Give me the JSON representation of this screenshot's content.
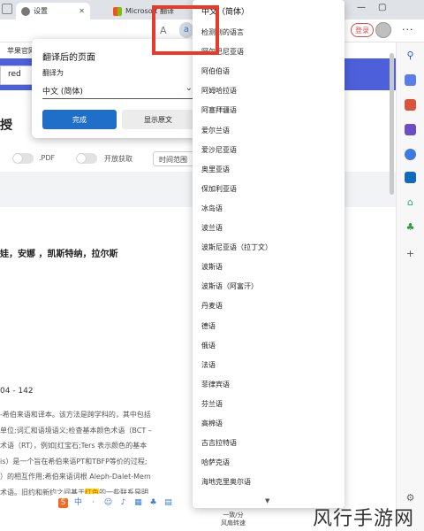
{
  "tabs": [
    {
      "title": "设置",
      "close": "✕"
    },
    {
      "title": "Microsoft 翻译",
      "close": "✕"
    }
  ],
  "window_controls": [
    "—",
    "▢"
  ],
  "toolbar": {
    "login_label": "登录",
    "more": "···",
    "read_aloud": "A",
    "translate_icon_text": "a"
  },
  "page": {
    "bookmark": "苹果官网",
    "search_value": "red",
    "big_char": "授",
    "filters": {
      "pdf": ".PDF",
      "open_access": "开放获取",
      "time_range": "时间范围"
    },
    "authors": "娃，安娜 ，凯斯特纳，拉尔斯",
    "pages": "04 - 142",
    "abstract_lines": [
      "-希伯来语和译本。该方法是跨学科的，其中包括",
      "单位;词汇和语境语义;检查基本颜色术语（BCT –",
      "术语（RT），例如[红宝石;Ters 表示颜色的基本",
      "is）是一个旨在希伯来语PT和TBFP等价的过程;",
      "）的相互作用;希伯来语词根 Aleph-Dalet-Mem",
      "术语。旧约和新约之间基于"
    ],
    "abstract_highlight": "红色",
    "abstract_tail": "的一些联系是明",
    "status_line1": "一致/分",
    "status_line2": "风扇转速"
  },
  "popup": {
    "title": "翻译后的页面",
    "label": "翻译为",
    "selected": "中文 (简体)",
    "done": "完成",
    "show_original": "显示原文"
  },
  "dropdown": {
    "current": "中文（简体）",
    "languages": [
      "检测到的语言",
      "阿尔巴尼亚语",
      "阿伯伯语",
      "阿姆哈拉语",
      "阿塞拜疆语",
      "爱尔兰语",
      "爱沙尼亚语",
      "奥里亚语",
      "保加利亚语",
      "冰岛语",
      "波兰语",
      "波斯尼亚语（拉丁文）",
      "波斯语",
      "波斯语（阿富汗）",
      "丹麦语",
      "德语",
      "俄语",
      "法语",
      "菲律宾语",
      "芬兰语",
      "高棉语",
      "古吉拉特语",
      "哈萨克语",
      "海地克里奥尔语"
    ],
    "down_arrow": "▼"
  },
  "watermark": "风行手游网"
}
